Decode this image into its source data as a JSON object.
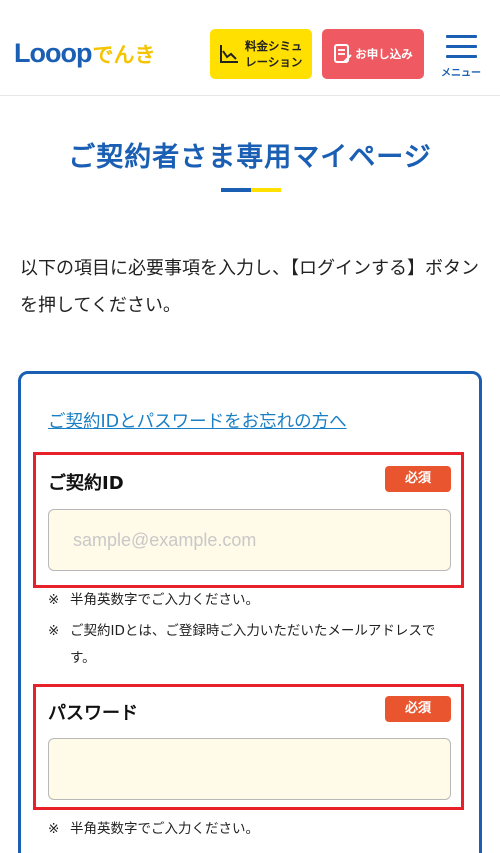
{
  "header": {
    "logo_main": "Looop",
    "logo_sub": "でんき",
    "simulation_label_line1": "料金シミュ",
    "simulation_label_line2": "レーション",
    "apply_label": "お申し込み",
    "menu_label": "メニュー",
    "colors": {
      "brand_blue": "#1a5fb4",
      "brand_yellow": "#ffe000",
      "apply_red": "#ef5a62"
    }
  },
  "page": {
    "title": "ご契約者さま専用マイページ",
    "intro": "以下の項目に必要事項を入力し、【ログインする】ボタンを押してください。"
  },
  "form": {
    "forgot_link": "ご契約IDとパスワードをお忘れの方へ",
    "contract_id": {
      "label": "ご契約ID",
      "required_badge": "必須",
      "value": "",
      "placeholder": "sample@example.com",
      "notes": [
        {
          "mark": "※",
          "text": "半角英数字でご入力ください。"
        },
        {
          "mark": "※",
          "text": "ご契約IDとは、ご登録時ご入力いただいたメールアドレスです。"
        }
      ]
    },
    "password": {
      "label": "パスワード",
      "required_badge": "必須",
      "value": "",
      "placeholder": "",
      "notes": [
        {
          "mark": "※",
          "text": "半角英数字でご入力ください。"
        }
      ]
    },
    "colors": {
      "highlight_red": "#e8202a",
      "badge_orange": "#e8552e",
      "input_bg": "#fffbe8"
    }
  }
}
